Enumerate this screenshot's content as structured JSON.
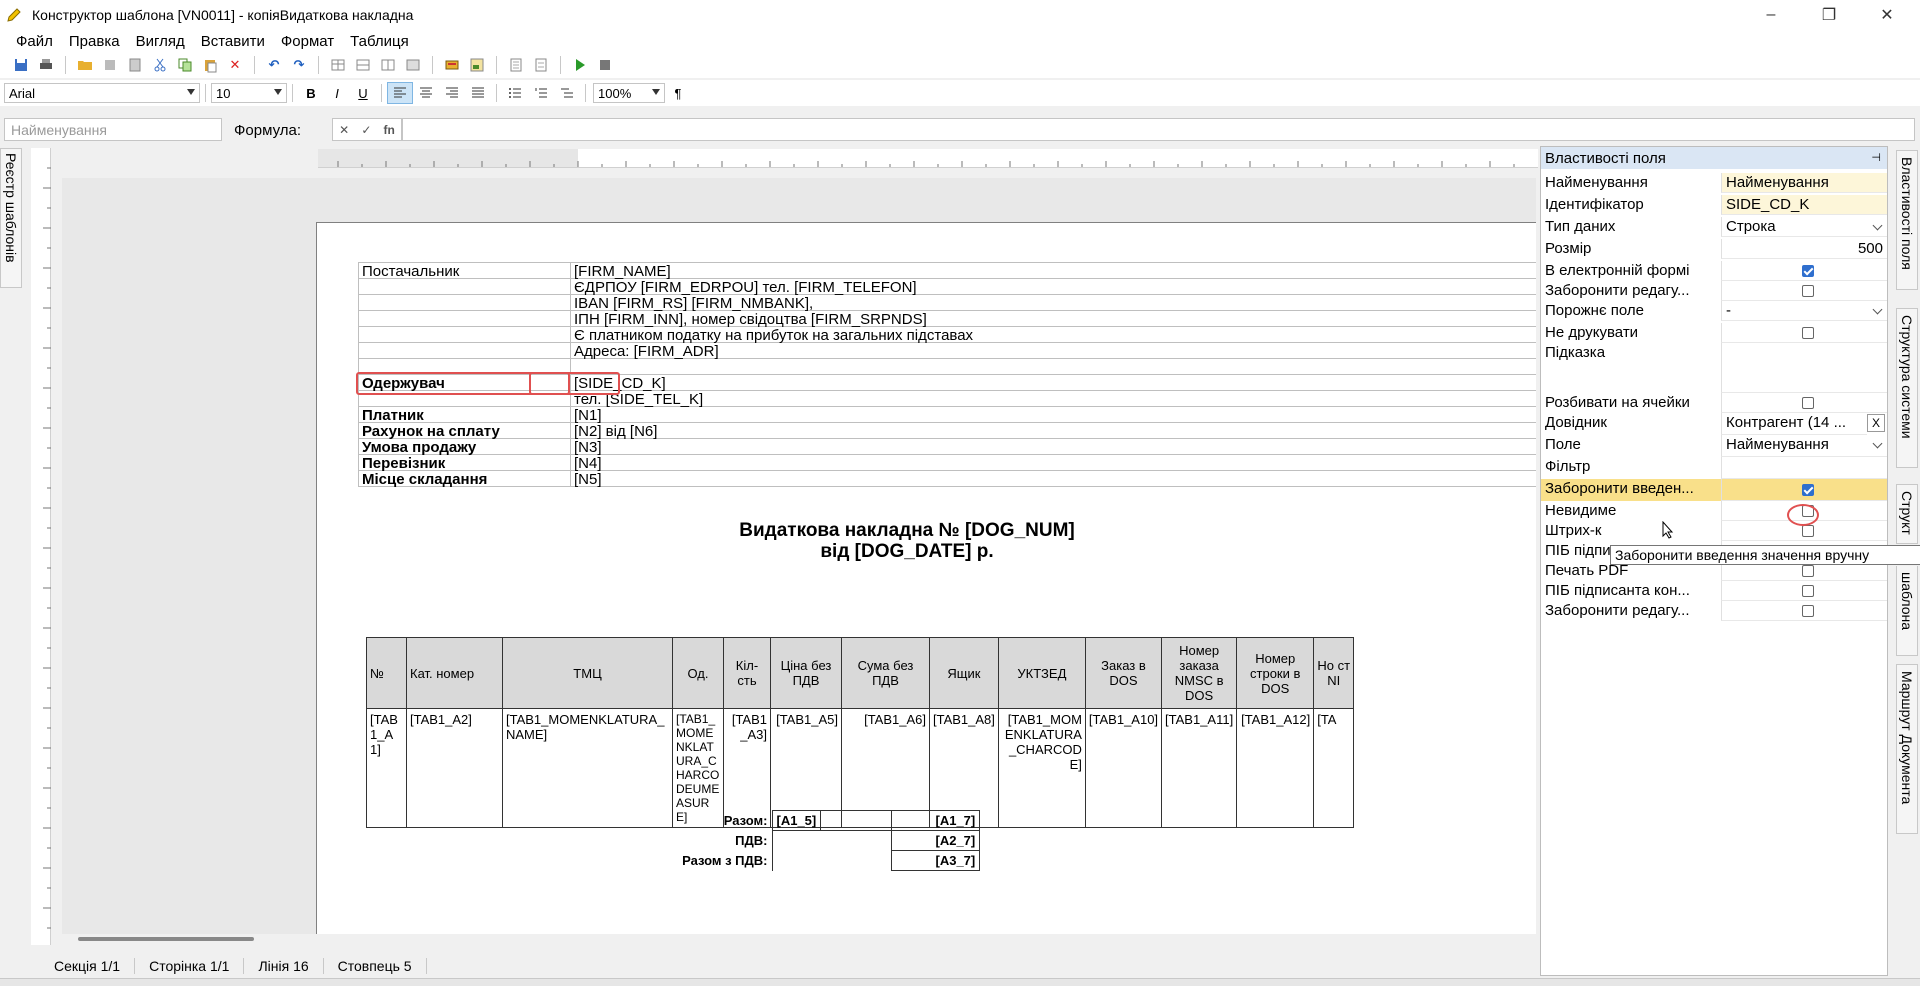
{
  "window": {
    "title": "Конструктор шаблона [VN0011] - копіяВидаткова накладна",
    "minimize": "–",
    "maximize": "❐",
    "close": "✕"
  },
  "menu": [
    "Файл",
    "Правка",
    "Вигляд",
    "Вставити",
    "Формат",
    "Таблиця"
  ],
  "format_bar": {
    "font": "Arial",
    "size": "10",
    "zoom": "100%",
    "bold": "B",
    "italic": "I",
    "underline": "U",
    "pilcrow": "¶"
  },
  "formula_bar": {
    "name_placeholder": "Найменування",
    "formula_label": "Формула:",
    "fn": "fn"
  },
  "left_tab": "Реєстр шаблонів",
  "right_tabs": [
    "Властивості поля",
    "Структура системи",
    "Структ",
    "шаблона",
    "Маршрут Документа"
  ],
  "document": {
    "supplier_label": "Постачальник",
    "supplier_lines": [
      "[FIRM_NAME]",
      "ЄДРПОУ [FIRM_EDRPOU] тел. [FIRM_TELEFON]",
      "IBAN [FIRM_RS] [FIRM_NMBANK],",
      "ІПН [FIRM_INN], номер свідоцтва [FIRM_SRPNDS]",
      "Є платником податку на прибуток на загальних підставах",
      "Адреса: [FIRM_ADR]"
    ],
    "receiver_label": "Одержувач",
    "receiver_value": "[SIDE_CD_K]",
    "receiver_tel": "тел. [SIDE_TEL_K]",
    "info_rows": [
      {
        "label": "Платник",
        "value": "[N1]"
      },
      {
        "label": "Рахунок на сплату",
        "value": "[N2] від [N6]"
      },
      {
        "label": "Умова продажу",
        "value": "[N3]"
      },
      {
        "label": "Перевізник",
        "value": "[N4]"
      },
      {
        "label": "Місце складання",
        "value": "[N5]"
      }
    ],
    "title_line1": "Видаткова накладна № [DOG_NUM]",
    "title_line2": "від  [DOG_DATE] р.",
    "table_headers": [
      "№",
      "Кат. номер",
      "ТМЦ",
      "Од.",
      "Кіл-сть",
      "Ціна без ПДВ",
      "Сума без ПДВ",
      "Ящик",
      "УКТЗЕД",
      "Заказ в DOS",
      "Номер заказа NMSC в DOS",
      "Номер строки в DOS",
      "Но ст NI"
    ],
    "table_row": [
      "[TAB1_A1]",
      "[TAB1_A2]",
      "[TAB1_MOMENKLATURA_NAME]",
      "[TAB1_MOMENKLATURA_CHARCODEUMEASURE]",
      "[TAB1_A3]",
      "[TAB1_A5]",
      "[TAB1_A6]",
      "[TAB1_A8]",
      "[TAB1_MOMENKLATURA_CHARCODE]",
      "[TAB1_A10]",
      "[TAB1_A11]",
      "[TAB1_A12]",
      "[TA"
    ],
    "totals": [
      {
        "label": "Разом:",
        "qty": "[A1_5]",
        "sum": "[A1_7]"
      },
      {
        "label": "ПДВ:",
        "qty": "",
        "sum": "[A2_7]"
      },
      {
        "label": "Разом з ПДВ:",
        "qty": "",
        "sum": "[A3_7]"
      }
    ]
  },
  "status": [
    "Секція 1/1",
    "Сторінка 1/1",
    "Лінія 16",
    "Стовпець 5"
  ],
  "properties": {
    "header": "Властивості поля",
    "rows": [
      {
        "label": "Найменування",
        "value": "Найменування"
      },
      {
        "label": "Ідентифікатор",
        "value": "SIDE_CD_K"
      },
      {
        "label": "Тип даних",
        "value": "Строка"
      },
      {
        "label": "Розмір",
        "value": "500"
      },
      {
        "label": "В електронній формі",
        "value": ""
      },
      {
        "label": "Заборонити редагу...",
        "value": ""
      },
      {
        "label": "Порожнє поле",
        "value": "-"
      },
      {
        "label": "Не друкувати",
        "value": ""
      },
      {
        "label": "Підказка",
        "value": ""
      },
      {
        "label": "Розбивати на ячейки",
        "value": ""
      },
      {
        "label": "Довідник",
        "value": "Контрагент (14 ..."
      },
      {
        "label": "Поле",
        "value": "Найменування"
      },
      {
        "label": "Фільтр",
        "value": ""
      },
      {
        "label": "Заборонити введен...",
        "value": ""
      },
      {
        "label": "Невидиме",
        "value": ""
      },
      {
        "label": "Штрих-к",
        "value": ""
      },
      {
        "label": "ПІБ підписанта",
        "value": ""
      },
      {
        "label": "Печать PDF",
        "value": ""
      },
      {
        "label": "ПІБ підписанта кон...",
        "value": ""
      },
      {
        "label": "Заборонити редагу...",
        "value": ""
      }
    ],
    "dictionary_clear": "X",
    "tooltip": "Заборонити введення значення вручну"
  },
  "colors": {
    "accent": "#2f6fce",
    "highlight": "#f9e08a",
    "annotation": "#e05050"
  }
}
